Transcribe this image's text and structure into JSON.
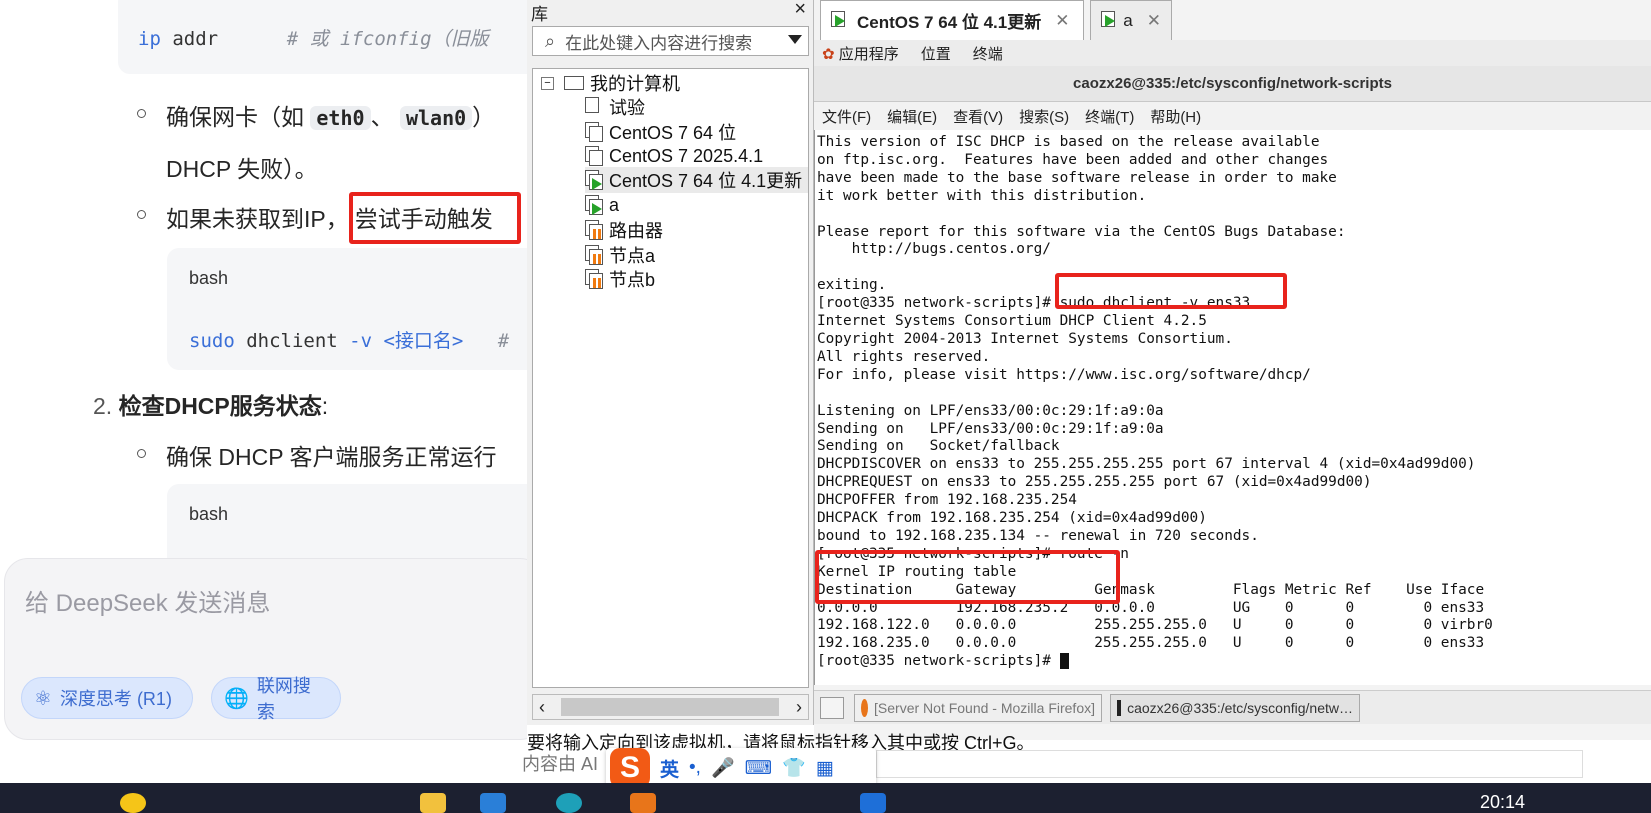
{
  "chat": {
    "code1_cmd": "ip",
    "code1_arg": " addr",
    "code1_comment": "# 或 ifconfig（旧版",
    "bullet1_pre": "确保网卡（如",
    "bullet1_pill1": "eth0",
    "bullet1_sep": "、",
    "bullet1_pill2": "wlan0",
    "bullet1_post": "）",
    "bullet1_line2": "DHCP 失败）。",
    "bullet2_pre": "如果未获取到IP，",
    "bullet2_box": "尝试手动触发",
    "code2_lang": "bash",
    "code2_cmd": "sudo",
    "code2_mid": " dhclient ",
    "code2_flag": "-v",
    "code2_arg": " <接口名>",
    "code2_comment": "#",
    "step2_num": "2.",
    "step2_title": "检查DHCP服务状态",
    "step2_colon": ":",
    "bullet3": "确保 DHCP 客户端服务正常运行",
    "code3_lang": "bash",
    "composer_placeholder": "给 DeepSeek 发送消息",
    "chip_deep": "深度思考 (R1)",
    "chip_web": "联网搜索"
  },
  "library": {
    "title": "库",
    "search_placeholder": "在此处键入内容进行搜索",
    "root": "我的计算机",
    "items": [
      {
        "label": "试验",
        "icon": "page"
      },
      {
        "label": "CentOS 7 64 位",
        "icon": "vm"
      },
      {
        "label": "CentOS 7 2025.4.1",
        "icon": "vm"
      },
      {
        "label": "CentOS 7 64 位 4.1更新",
        "icon": "vm-running"
      },
      {
        "label": "a",
        "icon": "vm-running"
      },
      {
        "label": "路由器",
        "icon": "vm-paused"
      },
      {
        "label": "节点a",
        "icon": "vm-paused"
      },
      {
        "label": "节点b",
        "icon": "vm-paused"
      }
    ]
  },
  "vm": {
    "tab1": "CentOS 7 64 位 4.1更新",
    "tab2": "a",
    "gnome_menu": [
      "应用程序",
      "位置",
      "终端"
    ],
    "terminal_title": "caozx26@335:/etc/sysconfig/network-scripts",
    "terminal_menu": [
      "文件(F)",
      "编辑(E)",
      "查看(V)",
      "搜索(S)",
      "终端(T)",
      "帮助(H)"
    ],
    "terminal_lines": [
      "This version of ISC DHCP is based on the release available",
      "on ftp.isc.org.  Features have been added and other changes",
      "have been made to the base software release in order to make",
      "it work better with this distribution.",
      "",
      "Please report for this software via the CentOS Bugs Database:",
      "    http://bugs.centos.org/",
      "",
      "exiting.",
      "[root@335 network-scripts]# sudo dhclient -v ens33",
      "Internet Systems Consortium DHCP Client 4.2.5",
      "Copyright 2004-2013 Internet Systems Consortium.",
      "All rights reserved.",
      "For info, please visit https://www.isc.org/software/dhcp/",
      "",
      "Listening on LPF/ens33/00:0c:29:1f:a9:0a",
      "Sending on   LPF/ens33/00:0c:29:1f:a9:0a",
      "Sending on   Socket/fallback",
      "DHCPDISCOVER on ens33 to 255.255.255.255 port 67 interval 4 (xid=0x4ad99d00)",
      "DHCPREQUEST on ens33 to 255.255.255.255 port 67 (xid=0x4ad99d00)",
      "DHCPOFFER from 192.168.235.254",
      "DHCPACK from 192.168.235.254 (xid=0x4ad99d00)",
      "bound to 192.168.235.134 -- renewal in 720 seconds.",
      "[root@335 network-scripts]# route -n",
      "Kernel IP routing table",
      "Destination     Gateway         Genmask         Flags Metric Ref    Use Iface",
      "0.0.0.0         192.168.235.2   0.0.0.0         UG    0      0        0 ens33",
      "192.168.122.0   0.0.0.0         255.255.255.0   U     0      0        0 virbr0",
      "192.168.235.0   0.0.0.0         255.255.255.0   U     0      0        0 ens33"
    ],
    "prompt_last": "[root@335 network-scripts]# ",
    "taskbar_firefox": "[Server Not Found - Mozilla Firefox]",
    "taskbar_terminal": "caozx26@335:/etc/sysconfig/netw…"
  },
  "bottom": {
    "hint": "要将输入定向到该虚拟机，请将鼠标指针移入其中或按 Ctrl+G。",
    "hint2": "内容由 AI",
    "ime_lang": "英",
    "clock": "20:14"
  },
  "colors": {
    "highlight_red": "#e8231c",
    "vm_running": "#27a22a",
    "vm_paused": "#f07a10",
    "chip_blue": "#3d6ccf"
  }
}
